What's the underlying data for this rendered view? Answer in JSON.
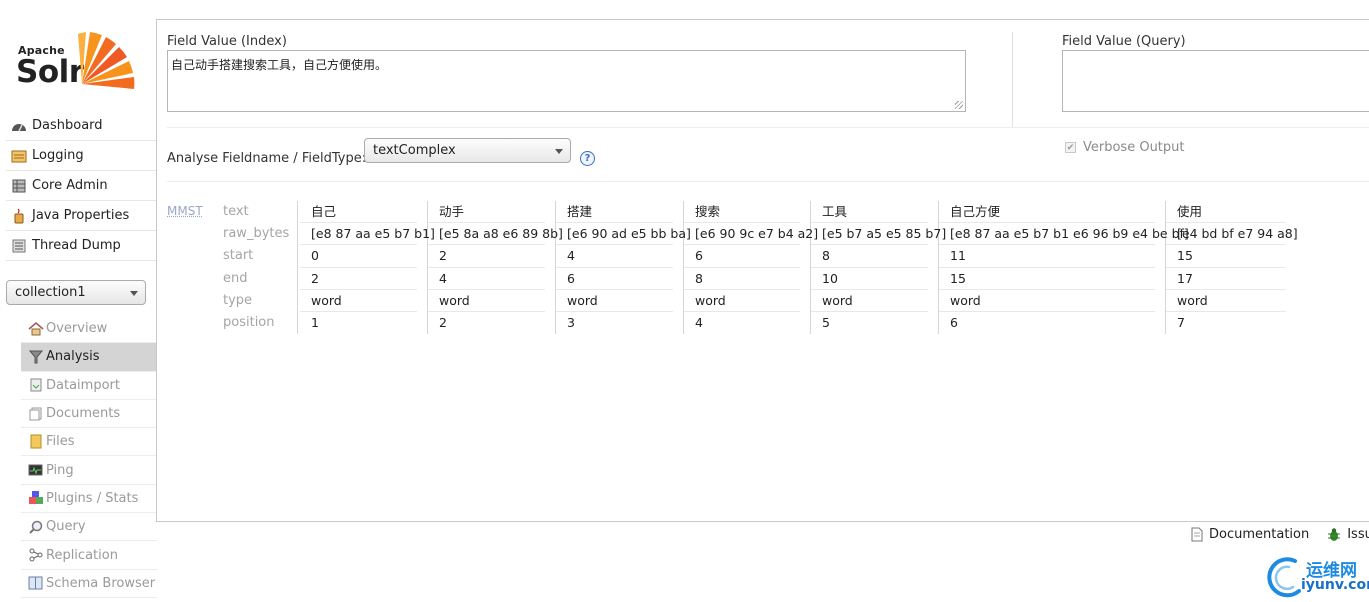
{
  "logo": {
    "apache": "Apache",
    "solr": "Solr"
  },
  "nav_main": [
    {
      "label": "Dashboard",
      "icon": "dashboard-icon"
    },
    {
      "label": "Logging",
      "icon": "logging-icon"
    },
    {
      "label": "Core Admin",
      "icon": "core-admin-icon"
    },
    {
      "label": "Java Properties",
      "icon": "java-icon"
    },
    {
      "label": "Thread Dump",
      "icon": "thread-dump-icon"
    }
  ],
  "core_selector": {
    "value": "collection1"
  },
  "nav_core": [
    {
      "label": "Overview",
      "icon": "home-icon"
    },
    {
      "label": "Analysis",
      "icon": "funnel-icon",
      "active": true
    },
    {
      "label": "Dataimport",
      "icon": "dataimport-icon"
    },
    {
      "label": "Documents",
      "icon": "documents-icon"
    },
    {
      "label": "Files",
      "icon": "files-icon"
    },
    {
      "label": "Ping",
      "icon": "ping-icon"
    },
    {
      "label": "Plugins / Stats",
      "icon": "plugins-icon"
    },
    {
      "label": "Query",
      "icon": "query-icon"
    },
    {
      "label": "Replication",
      "icon": "replication-icon"
    },
    {
      "label": "Schema Browser",
      "icon": "schema-browser-icon"
    }
  ],
  "analysis": {
    "index_label": "Field Value (Index)",
    "index_value": "自己动手搭建搜索工具，自己方便使用。",
    "query_label": "Field Value (Query)",
    "query_value": "",
    "fieldtype_label": "Analyse Fieldname / FieldType:",
    "fieldtype_value": "textComplex",
    "help_glyph": "?",
    "verbose_label": "Verbose Output",
    "verbose_checked": true,
    "mmst": "MMST",
    "row_labels": [
      "text",
      "raw_bytes",
      "start",
      "end",
      "type",
      "position"
    ],
    "tokens": [
      {
        "text": "自己",
        "raw_bytes": "[e8 87 aa e5 b7 b1]",
        "start": "0",
        "end": "2",
        "type": "word",
        "position": "1"
      },
      {
        "text": "动手",
        "raw_bytes": "[e5 8a a8 e6 89 8b]",
        "start": "2",
        "end": "4",
        "type": "word",
        "position": "2"
      },
      {
        "text": "搭建",
        "raw_bytes": "[e6 90 ad e5 bb ba]",
        "start": "4",
        "end": "6",
        "type": "word",
        "position": "3"
      },
      {
        "text": "搜索",
        "raw_bytes": "[e6 90 9c e7 b4 a2]",
        "start": "6",
        "end": "8",
        "type": "word",
        "position": "4"
      },
      {
        "text": "工具",
        "raw_bytes": "[e5 b7 a5 e5 85 b7]",
        "start": "8",
        "end": "10",
        "type": "word",
        "position": "5"
      },
      {
        "text": "自己方便",
        "raw_bytes": "[e8 87 aa e5 b7 b1 e6 96 b9 e4 be bf]",
        "start": "11",
        "end": "15",
        "type": "word",
        "position": "6"
      },
      {
        "text": "使用",
        "raw_bytes": "[e4 bd bf e7 94 a8]",
        "start": "15",
        "end": "17",
        "type": "word",
        "position": "7"
      }
    ]
  },
  "footer": {
    "documentation": "Documentation",
    "issues": "Issu"
  },
  "watermark": {
    "cn": "运维网",
    "en": "iyunv.com"
  },
  "colors": {
    "accent": "#3a6fc4",
    "active_bg": "#d4d4d4",
    "muted": "#9a9a9a",
    "logo_orange": "#f26b21"
  }
}
